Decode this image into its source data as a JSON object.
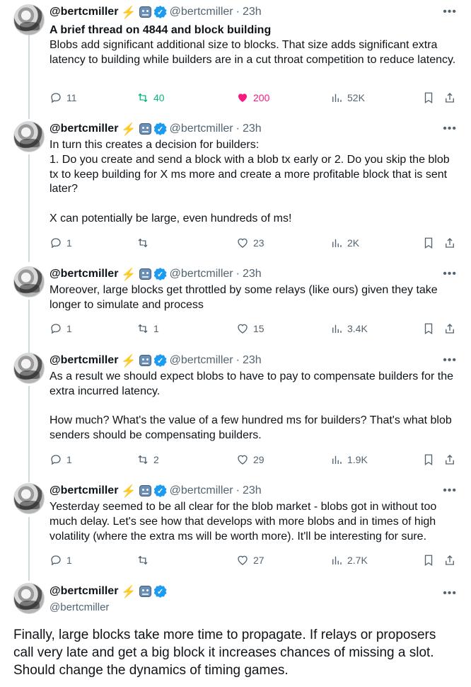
{
  "user": {
    "name": "@bertcmiller",
    "handle": "@bertcmiller",
    "bolt": "⚡",
    "verified_color": "#1d9bf0"
  },
  "tweets": [
    {
      "time": "23h",
      "paragraphs": [
        {
          "text": "A brief thread on 4844 and block building",
          "bold": true
        },
        {
          "text": "Blobs add significant additional size to blocks. That size adds significant extra latency to building while builders are in a cut throat competition to reduce latency.",
          "bold": false
        }
      ],
      "replies": "11",
      "retweets": "40",
      "likes": "200",
      "views": "52K"
    },
    {
      "time": "23h",
      "paragraphs": [
        {
          "text": "In turn this creates a decision for builders:"
        },
        {
          "text": "1. Do you create and send a block with a blob tx early or 2. Do you skip the blob tx to keep building for X ms more and create a more profitable block that is sent later?"
        },
        {
          "text": ""
        },
        {
          "text": "X can potentially be large, even hundreds of ms!"
        }
      ],
      "replies": "1",
      "retweets": "",
      "likes": "23",
      "views": "2K"
    },
    {
      "time": "23h",
      "paragraphs": [
        {
          "text": "Moreover, large blocks get throttled by some relays (like ours) given they take longer to simulate and process"
        }
      ],
      "replies": "1",
      "retweets": "1",
      "likes": "15",
      "views": "3.4K"
    },
    {
      "time": "23h",
      "paragraphs": [
        {
          "text": "As a result we should expect blobs to have to pay to compensate builders for the extra incurred latency."
        },
        {
          "text": ""
        },
        {
          "text": "How much? What's the value of a few hundred ms for builders? That's what blob senders should be compensating builders."
        }
      ],
      "replies": "1",
      "retweets": "2",
      "likes": "29",
      "views": "1.9K"
    },
    {
      "time": "23h",
      "paragraphs": [
        {
          "text": "Yesterday seemed to be all clear for the blob market - blobs got in without too much delay. Let's see how that develops with more blobs and in times of high volatility (where the extra ms will be worth more). It'll be interesting for sure."
        }
      ],
      "replies": "1",
      "retweets": "",
      "likes": "27",
      "views": "2.7K"
    }
  ],
  "final_tweet": {
    "text": "Finally, large blocks take more time to propagate. If relays or proposers call very late and get a big block it increases chances of missing a slot. Should change the dynamics of timing games."
  },
  "colors": {
    "text": "#0f1419",
    "muted": "#536471",
    "retweet_active": "#00ba7c",
    "like_active": "#f91880",
    "thread_line": "#cfd9de"
  },
  "icons": {
    "reply": "reply-icon",
    "retweet": "retweet-icon",
    "like": "heart-icon",
    "views": "views-icon",
    "bookmark": "bookmark-icon",
    "share": "share-icon",
    "more": "more-icon"
  }
}
